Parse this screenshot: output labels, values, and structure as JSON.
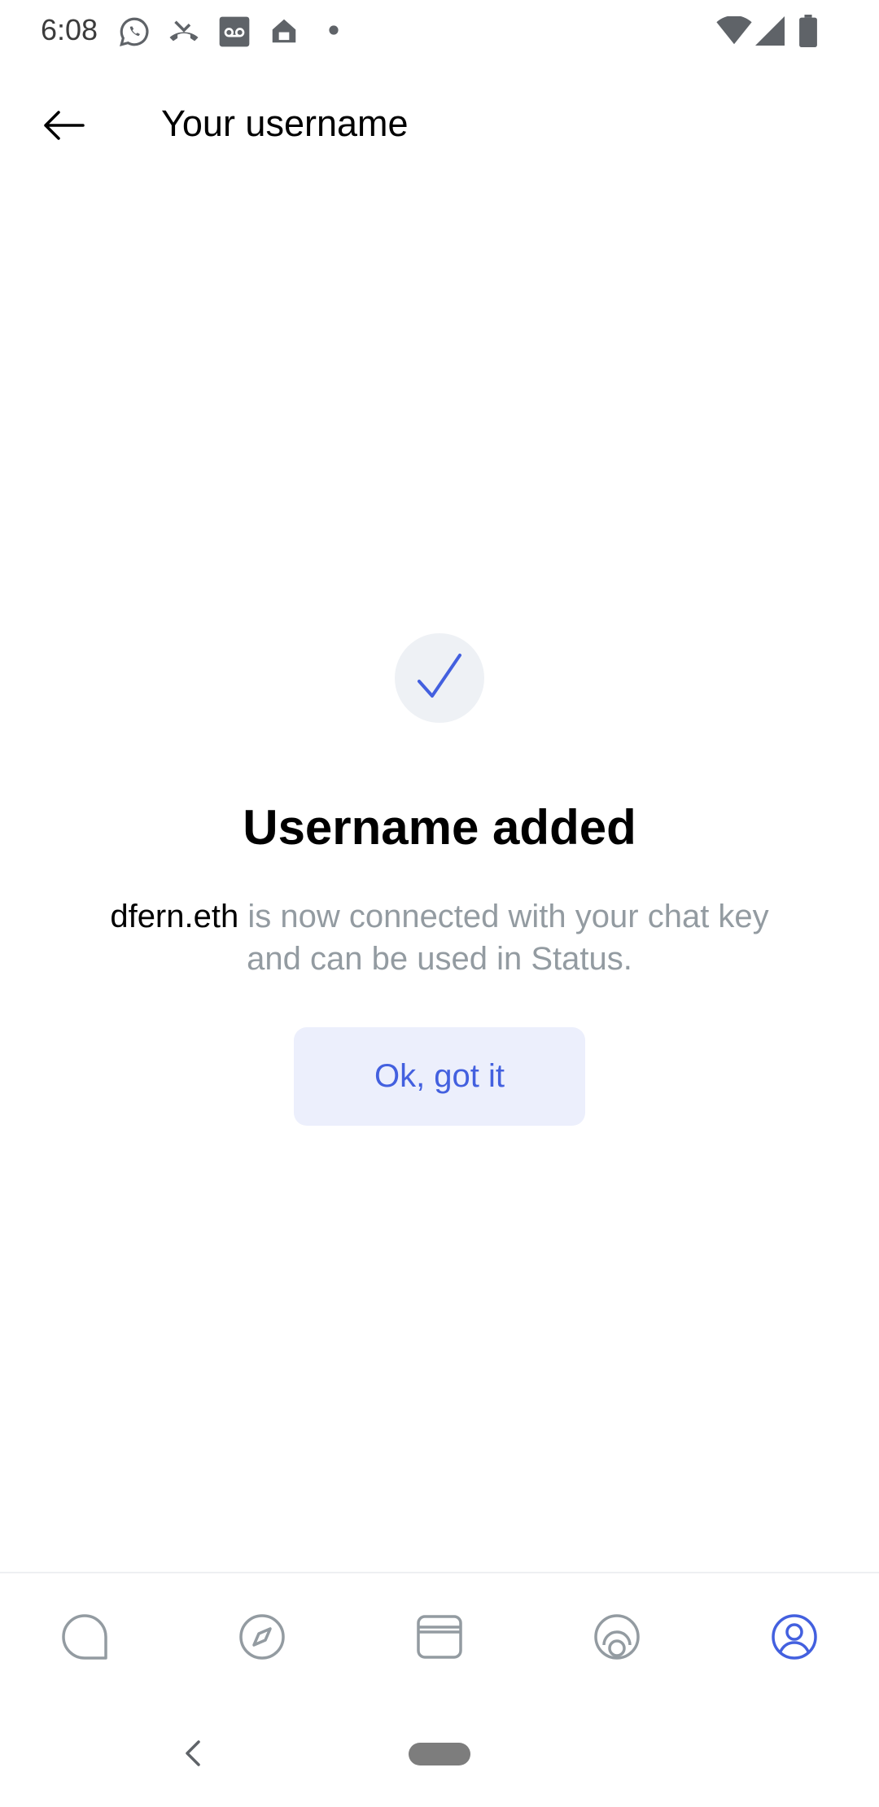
{
  "status_bar": {
    "time": "6:08",
    "icons_left": [
      "whatsapp-icon",
      "missed-call-icon",
      "voicemail-icon",
      "home-icon",
      "dot-icon"
    ],
    "icons_right": [
      "wifi-icon",
      "cell-signal-icon",
      "battery-icon"
    ]
  },
  "header": {
    "back_icon": "arrow-left-icon",
    "title": "Your username"
  },
  "success": {
    "icon": "checkmark-icon",
    "title": "Username added",
    "username": "dfern.eth",
    "description": " is now connected with your chat key and can be used in Status.",
    "button_label": "Ok, got it"
  },
  "tabs": [
    {
      "name": "chat",
      "icon": "chat-bubble-icon",
      "active": false
    },
    {
      "name": "browser",
      "icon": "compass-icon",
      "active": false
    },
    {
      "name": "wallet",
      "icon": "wallet-icon",
      "active": false
    },
    {
      "name": "status",
      "icon": "status-icon",
      "active": false
    },
    {
      "name": "profile",
      "icon": "profile-icon",
      "active": true
    }
  ],
  "colors": {
    "accent": "#4360df",
    "accent_light": "#eceffc",
    "secondary_text": "#939ba1",
    "inactive_icon": "#939ba1",
    "circle_bg": "#eef1f5"
  }
}
